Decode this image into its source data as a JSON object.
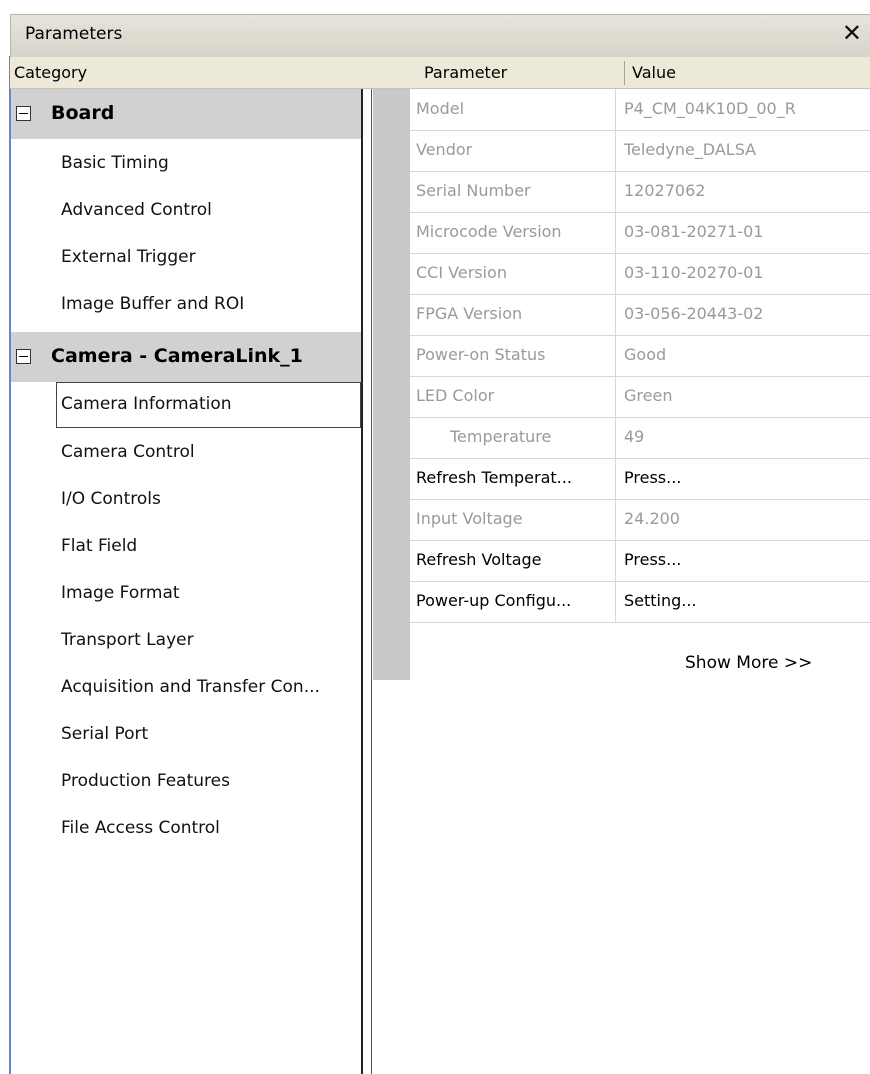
{
  "window": {
    "title": "Parameters"
  },
  "header": {
    "category": "Category",
    "parameter": "Parameter",
    "value": "Value"
  },
  "categories": {
    "board": {
      "label": "Board",
      "items": [
        "Basic Timing",
        "Advanced Control",
        "External Trigger",
        "Image Buffer and ROI"
      ]
    },
    "camera": {
      "label": "Camera - CameraLink_1",
      "selected": "Camera Information",
      "items": [
        "Camera Information",
        "Camera Control",
        "I/O Controls",
        "Flat Field",
        "Image Format",
        "Transport Layer",
        "Acquisition and Transfer Con...",
        "Serial Port",
        "Production Features",
        "File Access Control"
      ]
    }
  },
  "parameters": [
    {
      "name": "Model",
      "value": "P4_CM_04K10D_00_R",
      "enabled": false
    },
    {
      "name": "Vendor",
      "value": "Teledyne_DALSA",
      "enabled": false
    },
    {
      "name": "Serial Number",
      "value": "12027062",
      "enabled": false
    },
    {
      "name": "Microcode Version",
      "value": "03-081-20271-01",
      "enabled": false
    },
    {
      "name": "CCI Version",
      "value": "03-110-20270-01",
      "enabled": false
    },
    {
      "name": "FPGA Version",
      "value": "03-056-20443-02",
      "enabled": false
    },
    {
      "name": "Power-on Status",
      "value": "Good",
      "enabled": false
    },
    {
      "name": "LED Color",
      "value": "Green",
      "enabled": false
    },
    {
      "name": "Temperature",
      "value": "49",
      "enabled": false
    },
    {
      "name": "Refresh Temperat...",
      "value": "Press...",
      "enabled": true
    },
    {
      "name": "Input Voltage",
      "value": "24.200",
      "enabled": false
    },
    {
      "name": "Refresh Voltage",
      "value": "Press...",
      "enabled": true
    },
    {
      "name": "Power-up Configu...",
      "value": "Setting...",
      "enabled": true
    }
  ],
  "show_more": "Show More >>"
}
